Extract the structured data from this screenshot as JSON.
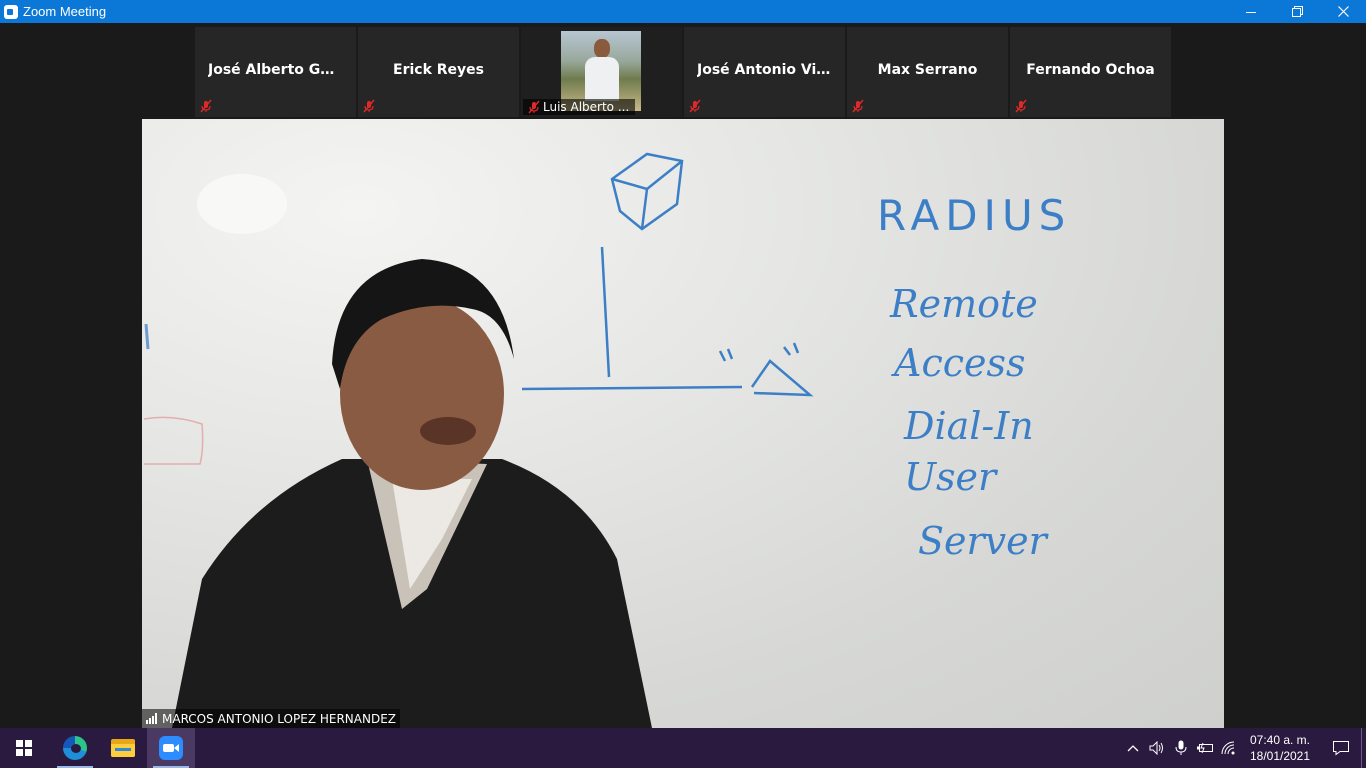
{
  "window": {
    "title": "Zoom Meeting",
    "controls": {
      "minimize": "—",
      "restore": "❐",
      "close": "✕"
    }
  },
  "gallery": [
    {
      "name": "José Alberto Gó...",
      "muted": true,
      "video": false
    },
    {
      "name": "Erick Reyes",
      "muted": true,
      "video": false
    },
    {
      "name": "Luis Alberto ...",
      "muted": true,
      "video": true
    },
    {
      "name": "José Antonio Vil...",
      "muted": true,
      "video": false
    },
    {
      "name": "Max Serrano",
      "muted": true,
      "video": false
    },
    {
      "name": "Fernando Ochoa",
      "muted": true,
      "video": false
    }
  ],
  "main_speaker": {
    "name": "MARCOS ANTONIO LOPEZ HERNANDEZ",
    "whiteboard_text": [
      "RADIUS",
      "Remote",
      "Access",
      "Dial-In",
      "User",
      "Server"
    ]
  },
  "taskbar": {
    "clock_time": "07:40 a. m.",
    "clock_date": "18/01/2021",
    "icons": [
      "windows-start-icon",
      "edge-browser-icon",
      "file-explorer-icon",
      "zoom-app-icon"
    ],
    "tray_icons": [
      "chevron-up-icon",
      "speaker-icon",
      "microphone-icon",
      "battery-icon",
      "wifi-icon",
      "notification-icon"
    ]
  }
}
